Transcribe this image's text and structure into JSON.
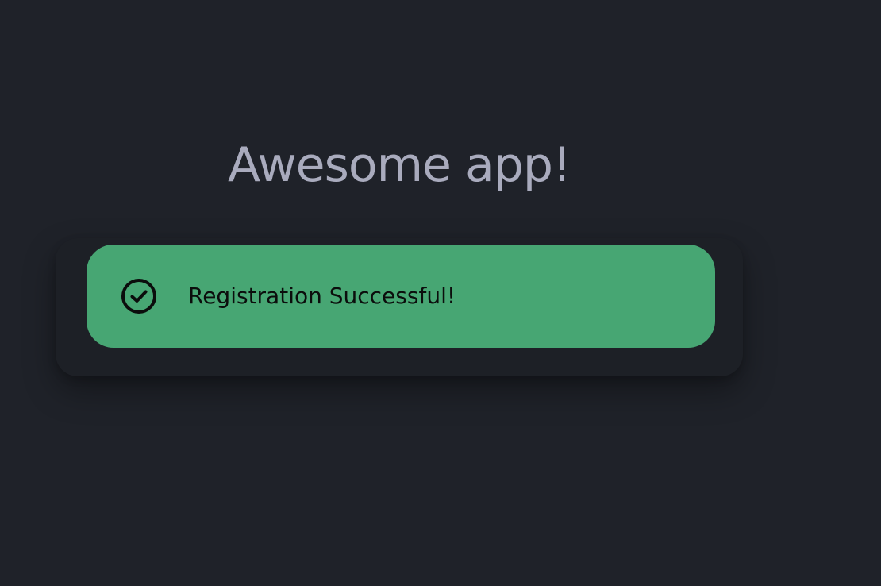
{
  "app": {
    "title": "Awesome app!"
  },
  "alert": {
    "message": "Registration Successful!",
    "icon": "check-circle-icon",
    "status": "success"
  },
  "colors": {
    "background": "#1f2229",
    "title": "#a9abbd",
    "success": "#47a673",
    "alert_text": "#0b0d0c"
  }
}
